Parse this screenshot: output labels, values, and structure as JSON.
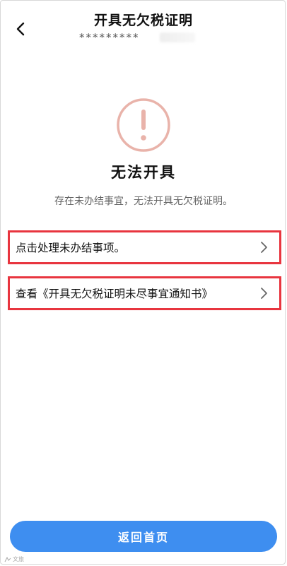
{
  "header": {
    "title": "开具无欠税证明",
    "subtitle_masked": "*********",
    "back_icon": "chevron-left-icon"
  },
  "status": {
    "icon": "exclamation-circle-icon",
    "icon_color": "#e9b3aa",
    "title": "无法开具",
    "description": "存在未办结事宜，无法开具无欠税证明。"
  },
  "actions": [
    {
      "label": "点击处理未办结事项。",
      "icon": "chevron-right-icon"
    },
    {
      "label": "查看《开具无欠税证明未尽事宜通知书》",
      "icon": "chevron-right-icon"
    }
  ],
  "highlight_color": "#e8353f",
  "footer": {
    "button_label": "返回首页",
    "button_color": "#3e8ef0"
  },
  "watermark": {
    "text": "文旅"
  }
}
